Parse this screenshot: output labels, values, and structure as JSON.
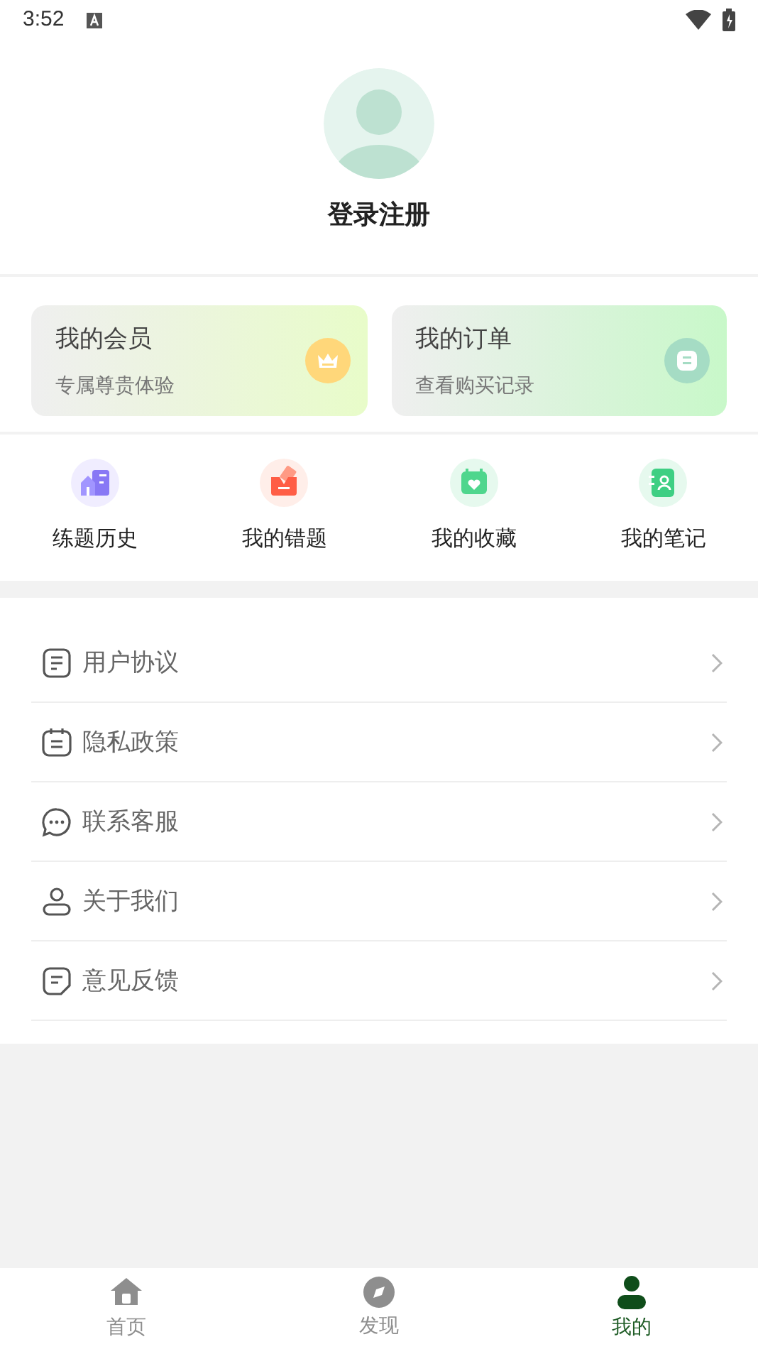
{
  "status_bar": {
    "time": "3:52"
  },
  "profile": {
    "login_label": "登录注册"
  },
  "cards": [
    {
      "kind": "member",
      "title": "我的会员",
      "subtitle": "专属尊贵体验"
    },
    {
      "kind": "order",
      "title": "我的订单",
      "subtitle": "查看购买记录"
    }
  ],
  "shortcuts": [
    {
      "kind": "history",
      "label": "练题历史"
    },
    {
      "kind": "mistakes",
      "label": "我的错题"
    },
    {
      "kind": "favorites",
      "label": "我的收藏"
    },
    {
      "kind": "notes",
      "label": "我的笔记"
    }
  ],
  "menu": [
    {
      "kind": "agreement",
      "label": "用户协议"
    },
    {
      "kind": "privacy",
      "label": "隐私政策"
    },
    {
      "kind": "service",
      "label": "联系客服"
    },
    {
      "kind": "about",
      "label": "关于我们"
    },
    {
      "kind": "feedback",
      "label": "意见反馈"
    }
  ],
  "tab_bar": [
    {
      "kind": "home",
      "label": "首页",
      "selected": false
    },
    {
      "kind": "discover",
      "label": "发现",
      "selected": false
    },
    {
      "kind": "me",
      "label": "我的",
      "selected": true
    }
  ]
}
